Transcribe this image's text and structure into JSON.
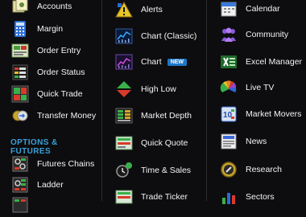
{
  "column1": {
    "items": [
      {
        "label": "Accounts",
        "icon": "accounts-icon"
      },
      {
        "label": "Margin",
        "icon": "margin-calculator-icon"
      },
      {
        "label": "Order Entry",
        "icon": "order-entry-icon"
      },
      {
        "label": "Order Status",
        "icon": "order-status-icon"
      },
      {
        "label": "Quick Trade",
        "icon": "quick-trade-icon"
      },
      {
        "label": "Transfer Money",
        "icon": "transfer-money-icon"
      }
    ],
    "section_title": "OPTIONS & FUTURES",
    "section_items": [
      {
        "label": "Futures Chains",
        "icon": "futures-chains-icon"
      },
      {
        "label": "Ladder",
        "icon": "ladder-icon"
      }
    ]
  },
  "column2": {
    "items": [
      {
        "label": "Alerts",
        "icon": "alerts-icon"
      },
      {
        "label": "Chart (Classic)",
        "icon": "chart-classic-icon"
      },
      {
        "label": "Chart",
        "icon": "chart-icon",
        "badge": "NEW"
      },
      {
        "label": "High Low",
        "icon": "high-low-icon"
      },
      {
        "label": "Market Depth",
        "icon": "market-depth-icon"
      },
      {
        "label": "Quick Quote",
        "icon": "quick-quote-icon"
      },
      {
        "label": "Time & Sales",
        "icon": "time-sales-icon"
      },
      {
        "label": "Trade Ticker",
        "icon": "trade-ticker-icon"
      }
    ]
  },
  "column3": {
    "items": [
      {
        "label": "Calendar",
        "icon": "calendar-icon"
      },
      {
        "label": "Community",
        "icon": "community-icon"
      },
      {
        "label": "Excel Manager",
        "icon": "excel-manager-icon"
      },
      {
        "label": "Live TV",
        "icon": "live-tv-icon"
      },
      {
        "label": "Market Movers",
        "icon": "market-movers-icon"
      },
      {
        "label": "News",
        "icon": "news-icon"
      },
      {
        "label": "Research",
        "icon": "research-icon"
      },
      {
        "label": "Sectors",
        "icon": "sectors-icon"
      }
    ]
  },
  "colors": {
    "background": "#0d0d0f",
    "section_title": "#3a9fd8",
    "badge": "#1f78c6",
    "divider": "#2a2b30"
  }
}
